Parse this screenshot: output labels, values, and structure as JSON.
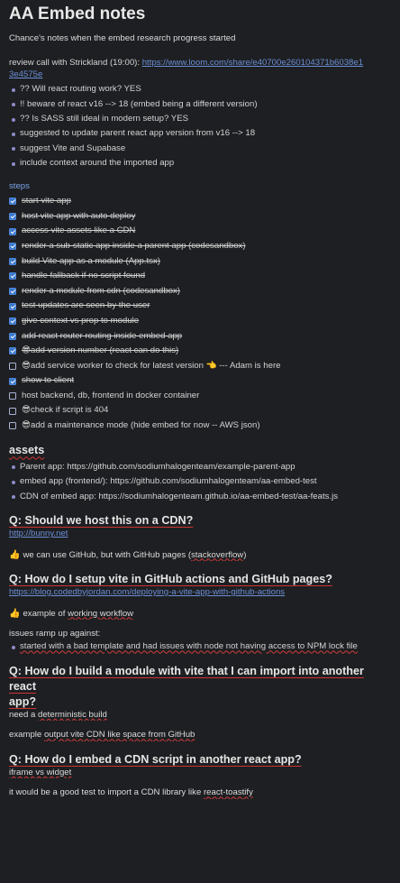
{
  "title": "AA Embed notes",
  "subtitle": "Chance's notes when the embed research progress started",
  "review": {
    "label": "review call with Strickland (19:00): ",
    "url_part1": "https://www.loom.com/share/e40700e260104371b6038e1",
    "url_part2": "3e4575e"
  },
  "review_bullets": [
    "?? Will react routing work? YES",
    "!! beware of react v16 --> 18 (embed being a different version)",
    "?? Is SASS still ideal in modern setup? YES",
    "suggested to update parent react app version from v16 --> 18",
    "suggest Vite and Supabase",
    "include context around the imported app"
  ],
  "steps_heading": "steps",
  "steps": [
    {
      "text": "start vite app",
      "checked": true
    },
    {
      "text": "host vite app with auto deploy",
      "checked": true
    },
    {
      "text": "access vite assets like a CDN",
      "checked": true
    },
    {
      "text": "render a sub-static app inside a parent app (codesandbox)",
      "checked": true
    },
    {
      "text": "build Vite app as a module (App.tsx)",
      "checked": true
    },
    {
      "text": "handle fallback if no script found",
      "checked": true
    },
    {
      "text": "render a module from cdn (codesandbox)",
      "checked": true
    },
    {
      "text": "test updates are seen by the user",
      "checked": true
    },
    {
      "text": "give context vs prop to module",
      "checked": true
    },
    {
      "text": "add react router routing inside embed app",
      "checked": true
    },
    {
      "text": "😎add version number (react can do this)",
      "checked": true
    },
    {
      "text": "😎add service worker to check for latest version 👈 --- Adam is here",
      "checked": false
    },
    {
      "text": "show to client",
      "checked": true
    },
    {
      "text": "host backend, db, frontend in docker container",
      "checked": false
    },
    {
      "text": "😎check if script is 404",
      "checked": false
    },
    {
      "text": "😎add a maintenance mode (hide embed for now -- AWS json)",
      "checked": false
    }
  ],
  "assets": {
    "heading": "assets",
    "items": [
      "Parent app: https://github.com/sodiumhalogenteam/example-parent-app",
      "embed app (frontend/): https://github.com/sodiumhalogenteam/aa-embed-test",
      "CDN of embed app: https://sodiumhalogenteam.github.io/aa-embed-test/aa-feats.js"
    ]
  },
  "q1": {
    "heading": "Q: Should we host this on a CDN?",
    "link": "http://bunny.net",
    "answer_prefix": "we can use GitHub, but with GitHub pages (",
    "answer_link": "stackoverflow",
    "answer_suffix": ")"
  },
  "q2": {
    "heading": "Q: How do I setup vite in GitHub actions and GitHub pages?",
    "link": "https://blog.codedbyjordan.com/deploying-a-vite-app-with-github-actions",
    "answer_prefix": "example of ",
    "answer_link": "working workflow",
    "ramp": "issues ramp up against:",
    "bullet": "started with a bad template and had issues with node not having access to NPM lock file"
  },
  "q3": {
    "heading_line1": "Q: How do I build a module with vite that I can import into another react",
    "heading_line2": "app?",
    "need_prefix": "need a ",
    "need_link": "deterministic build",
    "example_prefix": "example ",
    "example_link": "output vite CDN like space from GitHub"
  },
  "q4": {
    "heading": "Q: How do I embed a CDN script in another react app?",
    "iframe": "iframe vs widget",
    "note_prefix": "it would be a good test to import a CDN library like ",
    "note_link": "react-toastify"
  },
  "colors": {
    "background": "#1e1f22",
    "link": "#6b8fd6",
    "steps_heading": "#7aa2e8",
    "checkbox_checked": "#3a77c9",
    "bullet": "#8c8cc8",
    "spellcheck": "#d23b3b"
  }
}
